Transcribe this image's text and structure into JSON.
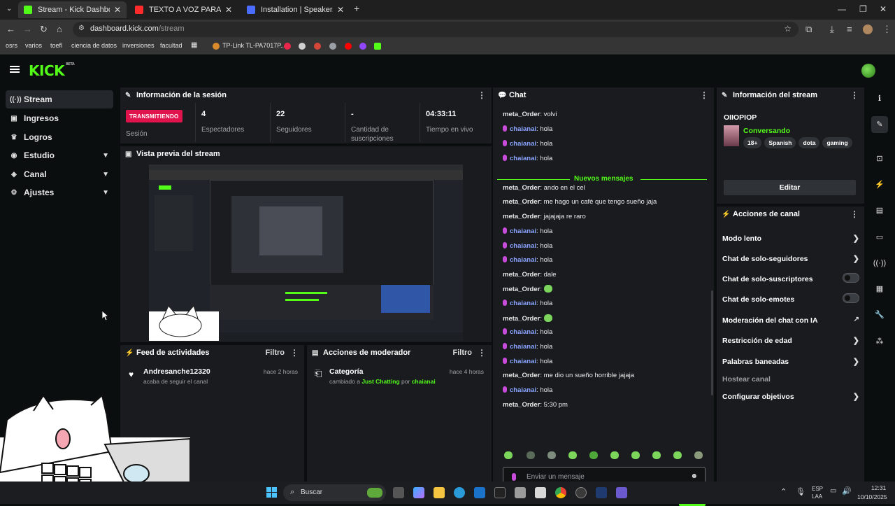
{
  "browser": {
    "tabs": [
      {
        "title": "Stream - Kick Dashboard",
        "active": true
      },
      {
        "title": "TEXTO A VOZ PARA TIKTOK, TW",
        "active": false
      },
      {
        "title": "Installation | Speaker.bot Docs",
        "active": false
      }
    ],
    "url_host": "dashboard.kick.com",
    "url_path": "/stream",
    "bookmarks": [
      "osrs",
      "varios",
      "toefl",
      "ciencia de datos",
      "inversiones",
      "facultad",
      "TP-Link TL-PA7017P..."
    ]
  },
  "sidebar": {
    "items": [
      {
        "label": "Stream",
        "icon": "broadcast-icon",
        "active": true
      },
      {
        "label": "Ingresos",
        "icon": "wallet-icon"
      },
      {
        "label": "Logros",
        "icon": "trophy-icon"
      },
      {
        "label": "Estudio",
        "icon": "studio-icon",
        "expandable": true
      },
      {
        "label": "Canal",
        "icon": "channel-icon",
        "expandable": true
      },
      {
        "label": "Ajustes",
        "icon": "gear-icon",
        "expandable": true
      }
    ]
  },
  "session": {
    "title": "Información de la sesión",
    "badge": "TRANSMITIENDO",
    "badge_label": "Sesión",
    "stats": [
      {
        "value": "4",
        "label": "Espectadores"
      },
      {
        "value": "22",
        "label": "Seguidores"
      },
      {
        "value": "-",
        "label": "Cantidad de suscripciones"
      },
      {
        "value": "04:33:11",
        "label": "Tiempo en vivo"
      }
    ]
  },
  "preview": {
    "title": "Vista previa del stream"
  },
  "feed": {
    "title": "Feed de actividades",
    "filter": "Filtro",
    "items": [
      {
        "user": "Andresanche12320",
        "text": "acaba de seguir el canal",
        "time": "hace 2 horas"
      }
    ]
  },
  "modactions": {
    "title": "Acciones de moderador",
    "filter": "Filtro",
    "items": [
      {
        "title": "Categoría",
        "prefix": "cambiado a",
        "category": "Just Chatting",
        "by": "por",
        "user": "chaianai",
        "time": "hace 4 horas"
      }
    ]
  },
  "chat": {
    "title": "Chat",
    "new_messages": "Nuevos mensajes",
    "input_placeholder": "Enviar un mensaje",
    "send_label": "Chat",
    "messages": [
      {
        "user": "meta_Order",
        "text": "volvi",
        "kind": "meta"
      },
      {
        "user": "chaianai",
        "text": "hola",
        "kind": "chai"
      },
      {
        "user": "chaianai",
        "text": "hola",
        "kind": "chai"
      },
      {
        "user": "chaianai",
        "text": "hola",
        "kind": "chai"
      },
      {
        "user": "meta_Order",
        "text": "ando en el cel",
        "kind": "meta"
      },
      {
        "user": "meta_Order",
        "text": "me hago un café que tengo sueño jaja",
        "kind": "meta"
      },
      {
        "user": "meta_Order",
        "text": "jajajaja re raro",
        "kind": "meta"
      },
      {
        "user": "chaianai",
        "text": "hola",
        "kind": "chai"
      },
      {
        "user": "chaianai",
        "text": "hola",
        "kind": "chai"
      },
      {
        "user": "chaianai",
        "text": "hola",
        "kind": "chai"
      },
      {
        "user": "meta_Order",
        "text": "dale",
        "kind": "meta"
      },
      {
        "user": "meta_Order",
        "text": "",
        "kind": "meta",
        "emote": true
      },
      {
        "user": "chaianai",
        "text": "hola",
        "kind": "chai"
      },
      {
        "user": "meta_Order",
        "text": "",
        "kind": "meta",
        "emote": true
      },
      {
        "user": "chaianai",
        "text": "hola",
        "kind": "chai"
      },
      {
        "user": "chaianai",
        "text": "hola",
        "kind": "chai"
      },
      {
        "user": "chaianai",
        "text": "hola",
        "kind": "chai"
      },
      {
        "user": "meta_Order",
        "text": "me dio un sueño horrible jajaja",
        "kind": "meta"
      },
      {
        "user": "chaianai",
        "text": "hola",
        "kind": "chai"
      },
      {
        "user": "meta_Order",
        "text": "5:30 pm",
        "kind": "meta"
      }
    ]
  },
  "streaminfo": {
    "title": "Información del stream",
    "stream_title": "OIIOPIOP",
    "category": "Conversando",
    "tags": [
      "18+",
      "Spanish",
      "dota",
      "gaming"
    ],
    "edit_label": "Editar"
  },
  "channel_actions": {
    "title": "Acciones de canal",
    "items": [
      {
        "label": "Modo lento",
        "kind": "arrow"
      },
      {
        "label": "Chat de solo-seguidores",
        "kind": "arrow"
      },
      {
        "label": "Chat de solo-suscriptores",
        "kind": "toggle"
      },
      {
        "label": "Chat de solo-emotes",
        "kind": "toggle"
      },
      {
        "label": "Moderación del chat con IA",
        "kind": "external"
      },
      {
        "label": "Restricción de edad",
        "kind": "arrow"
      },
      {
        "label": "Palabras baneadas",
        "kind": "arrow"
      },
      {
        "label": "Hostear canal",
        "kind": "disabled"
      },
      {
        "label": "Configurar objetivos",
        "kind": "arrow"
      }
    ]
  },
  "taskbar": {
    "search": "Buscar",
    "lang1": "ESP",
    "lang2": "LAA",
    "time": "12:31",
    "date": "10/10/2025"
  },
  "colors": {
    "kick_green": "#53fc18",
    "live_red": "#e0134d",
    "panel": "#191b1f",
    "chat_user": "#8aa4ff"
  }
}
